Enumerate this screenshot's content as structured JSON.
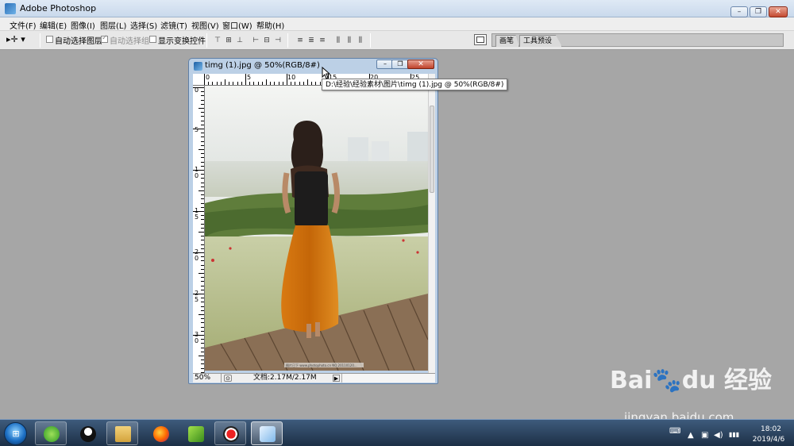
{
  "app": {
    "title": "Adobe Photoshop"
  },
  "window_controls": {
    "minimize": "–",
    "restore": "❐",
    "close": "✕"
  },
  "menus": [
    "文件(F)",
    "编辑(E)",
    "图像(I)",
    "图层(L)",
    "选择(S)",
    "滤镜(T)",
    "视图(V)",
    "窗口(W)",
    "帮助(H)"
  ],
  "options": {
    "tool_glyph": "▸✛ ▾",
    "auto_select_layer": "自动选择图层",
    "auto_select_group": "自动选择组",
    "show_transform": "显示变换控件",
    "align_glyphs": [
      "⊤",
      "⊞",
      "⊥",
      "⊢",
      "⊟",
      "⊣"
    ],
    "distribute_glyphs": [
      "≡",
      "≣",
      "≡",
      "⫼",
      "⫼",
      "⫼"
    ]
  },
  "palette_well": {
    "tabs": [
      "画笔",
      "工具预设"
    ]
  },
  "document": {
    "title": "timg (1).jpg @ 50%(RGB/8#)",
    "zoom": "50%",
    "doc_info": "文档:2.17M/2.17M",
    "status_arrow": "▶",
    "ruler_top_labels": [
      "0",
      "5",
      "10",
      "15",
      "20",
      "25"
    ],
    "ruler_left_labels": [
      "0",
      "5",
      "1\n0",
      "1\n5",
      "2\n0",
      "2\n5",
      "3\n0"
    ],
    "image_credit": "图片已下  www.photophoto.cn  NO.20110120..."
  },
  "tooltip": {
    "text": "D:\\经验\\经验素材\\图片\\timg (1).jpg @ 50%(RGB/8#)"
  },
  "taskbar": {
    "tray": [
      "⌨",
      "▲",
      "▣",
      "◀)",
      "▮▮▮"
    ],
    "time": "18:02",
    "date": "2019/4/6"
  },
  "watermark": {
    "logo": "Bai🐾du 经验",
    "url": "jingyan.baidu.com"
  },
  "colors": {
    "workspace": "#a6a6a6",
    "titlebar": "#c9d9ec",
    "taskbar": "#1c2f46",
    "accent": "#c0432b"
  }
}
